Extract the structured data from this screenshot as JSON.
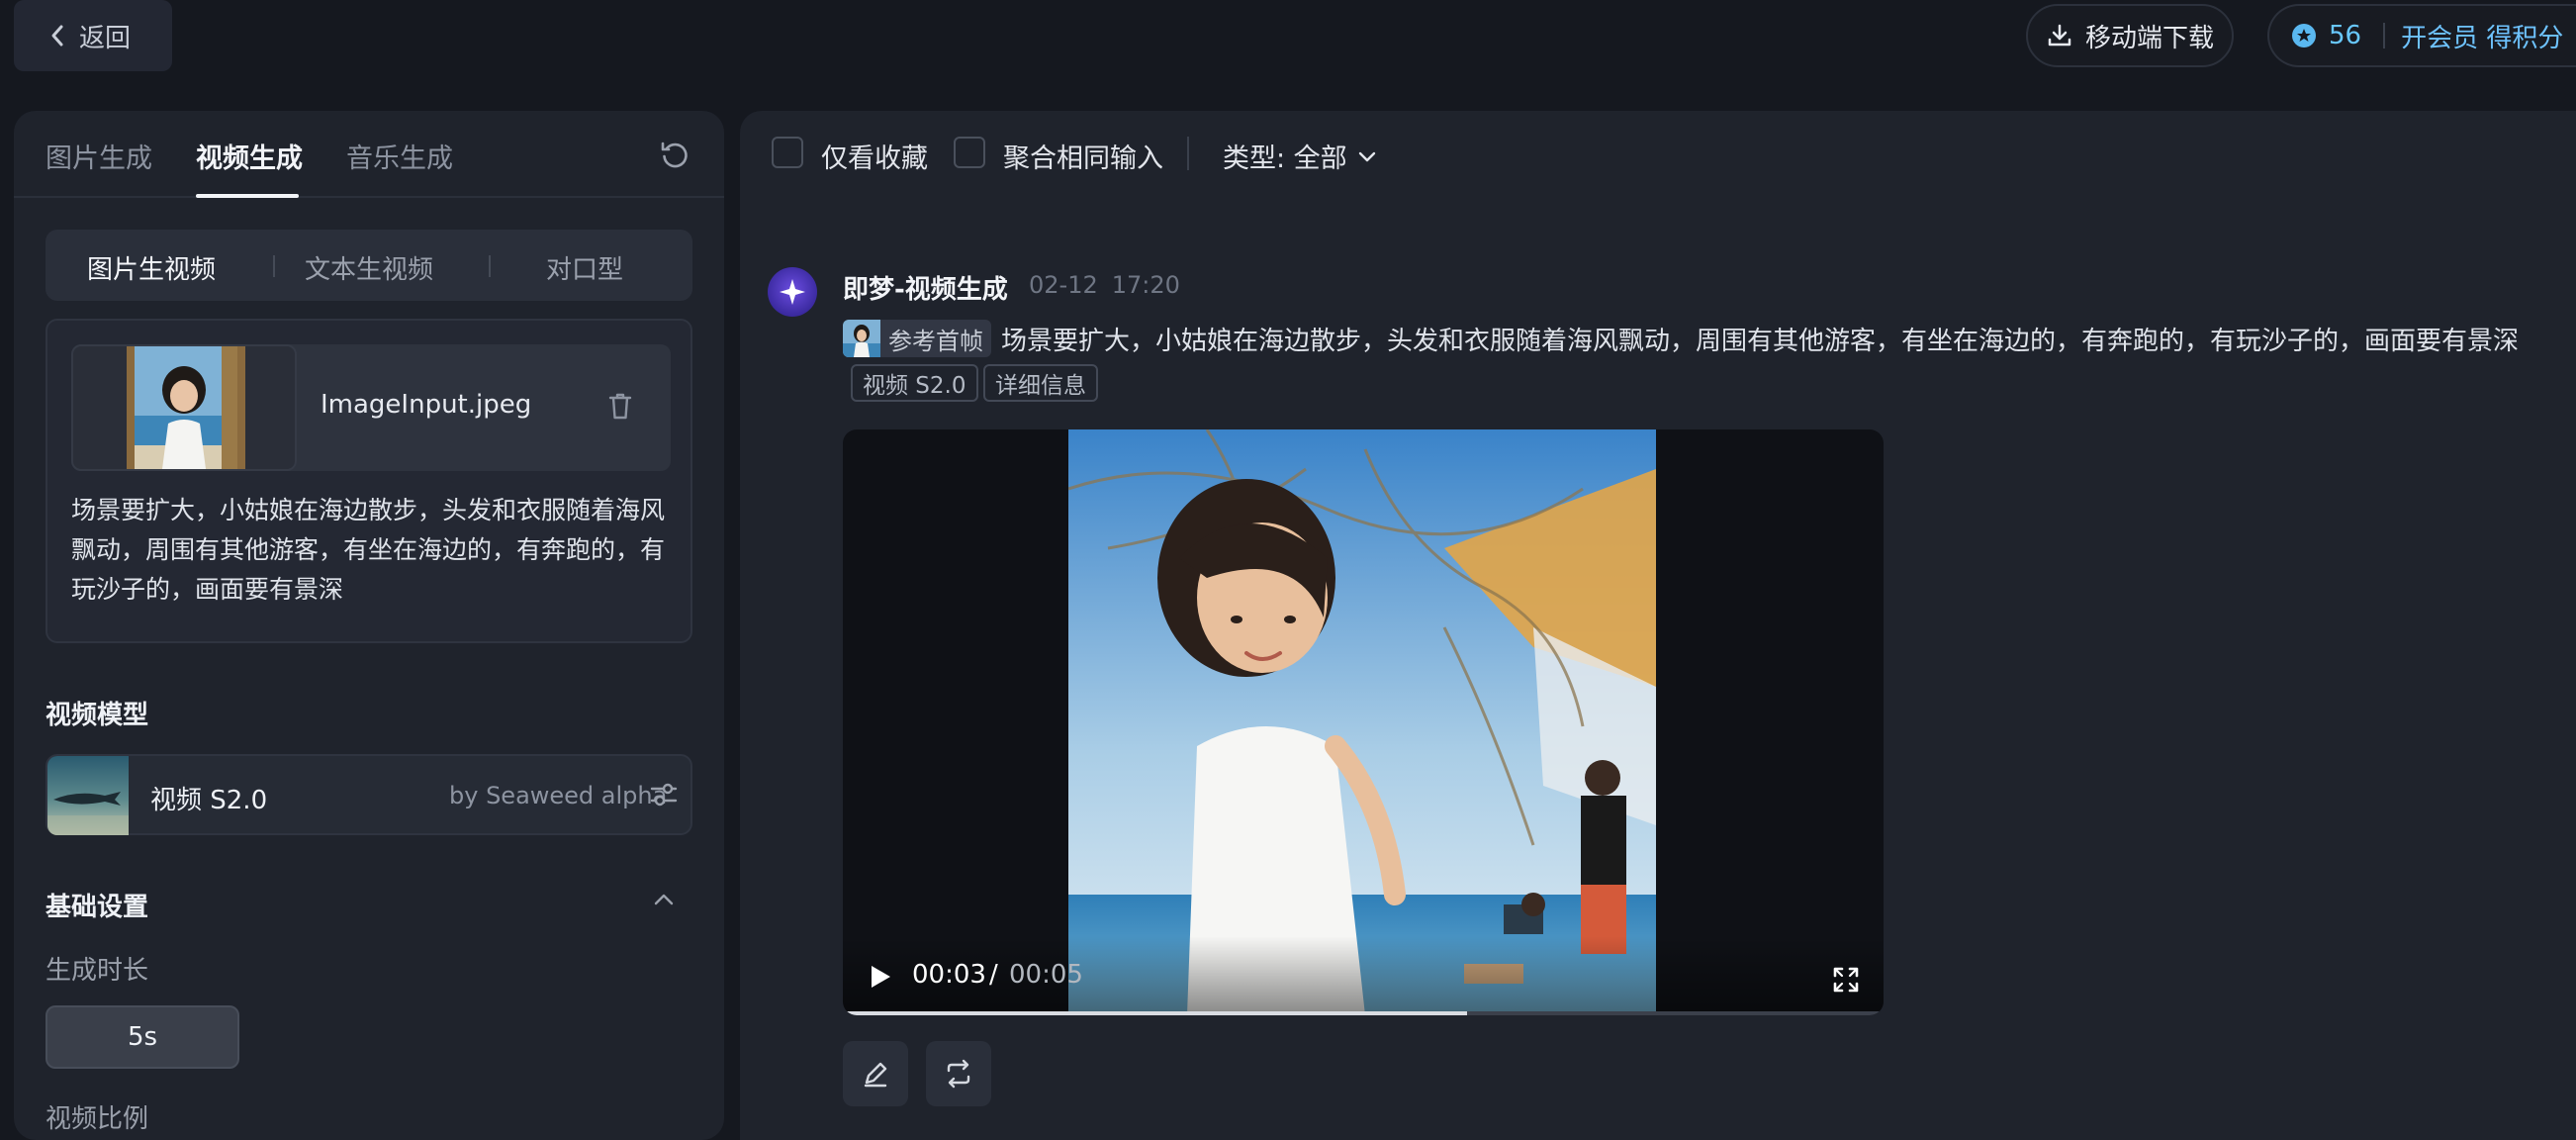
{
  "topbar": {
    "back_label": "返回",
    "download_label": "移动端下载",
    "credits": "56",
    "vip_label": "开会员 得积分"
  },
  "left": {
    "tabs": [
      {
        "label": "图片生成"
      },
      {
        "label": "视频生成"
      },
      {
        "label": "音乐生成"
      }
    ],
    "active_tab": "视频生成",
    "segments": [
      {
        "label": "图片生视频"
      },
      {
        "label": "文本生视频"
      },
      {
        "label": "对口型"
      }
    ],
    "active_segment": "图片生视频",
    "file_name": "ImageInput.jpeg",
    "prompt": "场景要扩大，小姑娘在海边散步，头发和衣服随着海风飘动，周围有其他游客，有坐在海边的，有奔跑的，有玩沙子的，画面要有景深",
    "model_section": "视频模型",
    "model_name": "视频 S2.0",
    "model_by": "by Seaweed alpha",
    "basic_settings": "基础设置",
    "duration_label": "生成时长",
    "duration_value": "5s",
    "ratio_label": "视频比例"
  },
  "right": {
    "filters": {
      "favorites_only": "仅看收藏",
      "group_same_input": "聚合相同输入",
      "type_label": "类型: 全部"
    },
    "generation": {
      "title": "即梦-视频生成",
      "date": "02-12",
      "time": "17:20",
      "ref_label": "参考首帧",
      "prompt": "场景要扩大，小姑娘在海边散步，头发和衣服随着海风飘动，周围有其他游客，有坐在海边的，有奔跑的，有玩沙子的，画面要有景深",
      "tags": [
        "视频 S2.0",
        "详细信息"
      ],
      "video": {
        "current_time": "00:03",
        "separator": "/",
        "total_time": "00:05",
        "progress": 0.6
      }
    }
  },
  "colors": {
    "accent_blue": "#68c8ff",
    "panel_bg": "#1f232c",
    "page_bg": "#15181f"
  },
  "icons": {
    "back": "chevron-left-icon",
    "download": "download-icon",
    "credit": "star-coin-icon",
    "refresh": "refresh-icon",
    "trash": "trash-icon",
    "adjust": "sliders-icon",
    "collapse": "chevron-up-icon",
    "dropdown": "chevron-down-icon",
    "play": "play-icon",
    "fullscreen": "fullscreen-icon",
    "edit": "edit-icon",
    "regenerate": "regenerate-icon"
  }
}
